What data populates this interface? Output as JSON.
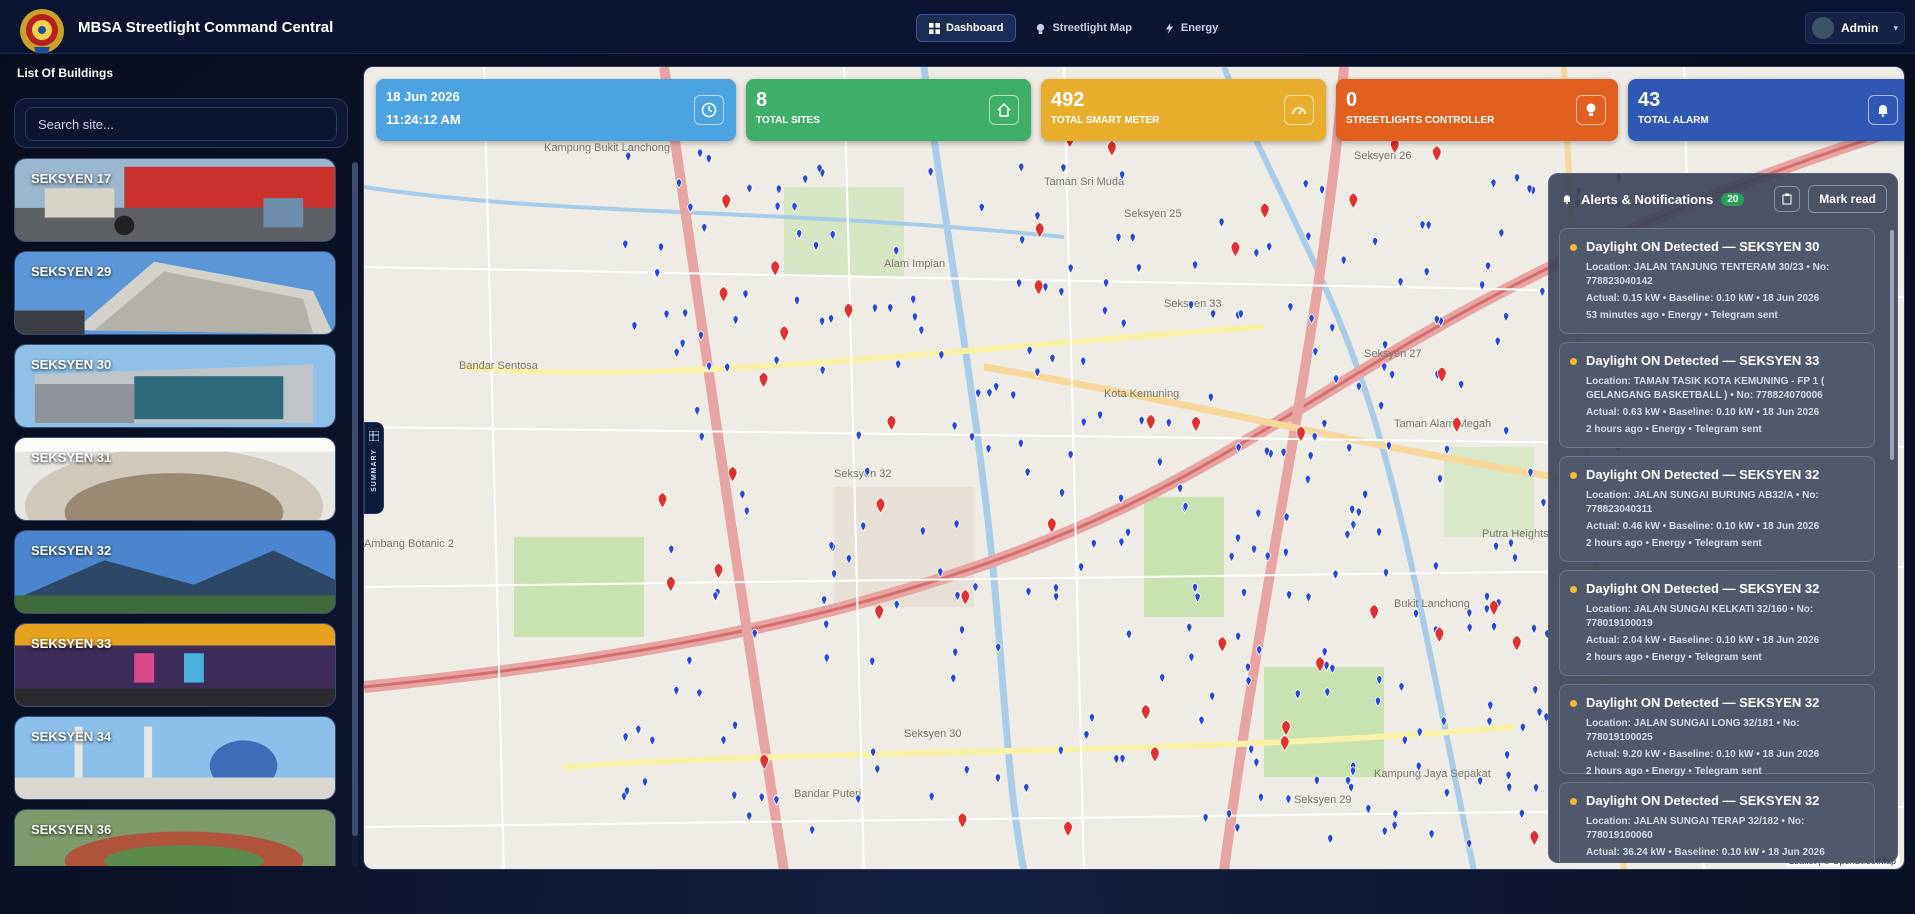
{
  "header": {
    "title": "MBSA Streetlight Command Central",
    "nav": [
      {
        "label": "Dashboard",
        "icon": "dashboard-icon",
        "active": true
      },
      {
        "label": "Streetlight Map",
        "icon": "bulb-icon",
        "active": false
      },
      {
        "label": "Energy",
        "icon": "bolt-icon",
        "active": false
      }
    ],
    "user": "Admin"
  },
  "sidebar": {
    "title": "List Of Buildings",
    "search_placeholder": "Search site...",
    "sites": [
      {
        "label": "SEKSYEN 17"
      },
      {
        "label": "SEKSYEN 29"
      },
      {
        "label": "SEKSYEN 30"
      },
      {
        "label": "SEKSYEN 31"
      },
      {
        "label": "SEKSYEN 32"
      },
      {
        "label": "SEKSYEN 33"
      },
      {
        "label": "SEKSYEN 34"
      },
      {
        "label": "SEKSYEN 36"
      }
    ]
  },
  "summary_tab": "SUMMARY",
  "stats": {
    "date": "18 Jun 2026",
    "time": "11:24:12 AM",
    "cards": [
      {
        "value": "8",
        "label": "TOTAL SITES",
        "color": "#3fae6a",
        "icon": "home-icon"
      },
      {
        "value": "492",
        "label": "TOTAL SMART METER",
        "color": "#e9ad2e",
        "icon": "gauge-icon"
      },
      {
        "value": "0",
        "label": "STREETLIGHTS CONTROLLER",
        "color": "#e2601f",
        "icon": "bulb-icon"
      },
      {
        "value": "43",
        "label": "TOTAL ALARM",
        "color": "#2f58b5",
        "icon": "bell-icon"
      }
    ],
    "clock_color": "#4ba3e2"
  },
  "alerts": {
    "title": "Alerts & Notifications",
    "count": "20",
    "mark_read": "Mark read",
    "items": [
      {
        "title": "Daylight ON Detected — SEKSYEN 30",
        "location": "Location: JALAN TANJUNG TENTERAM 30/23 • No: 778823040142",
        "metrics": "Actual: 0.15 kW • Baseline: 0.10 kW • 18 Jun 2026",
        "ago": "53 minutes ago • Energy • Telegram sent"
      },
      {
        "title": "Daylight ON Detected — SEKSYEN 33",
        "location": "Location: TAMAN TASIK KOTA KEMUNING - FP 1 ( GELANGANG BASKETBALL ) • No: 778824070006",
        "metrics": "Actual: 0.63 kW • Baseline: 0.10 kW • 18 Jun 2026",
        "ago": "2 hours ago • Energy • Telegram sent"
      },
      {
        "title": "Daylight ON Detected — SEKSYEN 32",
        "location": "Location: JALAN SUNGAI BURUNG AB32/A • No: 778823040311",
        "metrics": "Actual: 0.46 kW • Baseline: 0.10 kW • 18 Jun 2026",
        "ago": "2 hours ago • Energy • Telegram sent"
      },
      {
        "title": "Daylight ON Detected — SEKSYEN 32",
        "location": "Location: JALAN SUNGAI KELKATI 32/160 • No: 778019100019",
        "metrics": "Actual: 2.04 kW • Baseline: 0.10 kW • 18 Jun 2026",
        "ago": "2 hours ago • Energy • Telegram sent"
      },
      {
        "title": "Daylight ON Detected — SEKSYEN 32",
        "location": "Location: JALAN SUNGAI LONG 32/181 • No: 778019100025",
        "metrics": "Actual: 9.20 kW • Baseline: 0.10 kW • 18 Jun 2026",
        "ago": "2 hours ago • Energy • Telegram sent"
      },
      {
        "title": "Daylight ON Detected — SEKSYEN 32",
        "location": "Location: JALAN SUNGAI TERAP 32/182 • No: 778019100060",
        "metrics": "Actual: 36.24 kW • Baseline: 0.10 kW • 18 Jun 2026",
        "ago": ""
      }
    ]
  },
  "map": {
    "labels": [
      "Taman Sri Muda",
      "Alam Impian",
      "Bandar Sentosa",
      "Kota Kemuning",
      "Seksyen 30",
      "Seksyen 29",
      "Seksyen 27",
      "Seksyen 26",
      "Seksyen 25",
      "Seksyen 33",
      "Taman Alam Megah",
      "Putra Heights",
      "Kampung Jaya Sepakat",
      "Bukit Lanchong",
      "Ambang Botanic 2",
      "Bandar Puteri",
      "Seksyen 32",
      "Kampung Bukit Lanchong"
    ],
    "attribution": "Leaflet | © OpenStreetMap"
  }
}
